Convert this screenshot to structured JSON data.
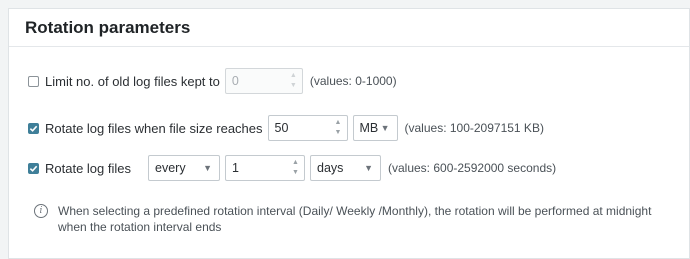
{
  "header": {
    "title": "Rotation parameters"
  },
  "rows": {
    "limit": {
      "checked": false,
      "label": "Limit no. of old log files kept to",
      "value": "0",
      "hint": "(values: 0-1000)"
    },
    "size": {
      "checked": true,
      "label": "Rotate log files when file size reaches",
      "value": "50",
      "unit": "MB",
      "hint": "(values: 100-2097151 KB)"
    },
    "interval": {
      "checked": true,
      "label": "Rotate log files",
      "frequency": "every",
      "value": "1",
      "unit": "days",
      "hint": "(values: 600-2592000 seconds)"
    }
  },
  "info": {
    "icon": "info-icon",
    "text": "When selecting a predefined rotation interval (Daily/ Weekly /Monthly), the rotation will be performed at midnight when the rotation interval ends"
  },
  "colors": {
    "accent": "#3f7f99",
    "background": "#f2f4f5"
  }
}
